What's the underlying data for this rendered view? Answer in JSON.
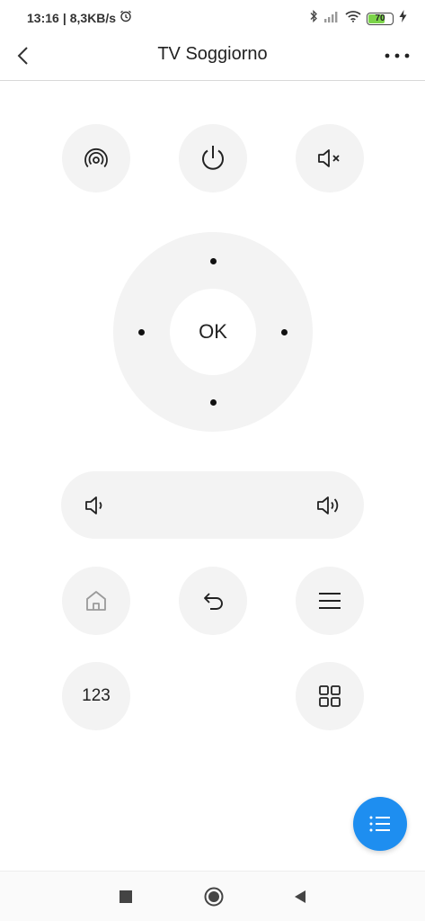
{
  "status_bar": {
    "time": "13:16",
    "speed": "8,3KB/s",
    "battery": "70",
    "battery_level": 0.7,
    "icons": [
      "alarm-icon",
      "bluetooth-icon",
      "signal-icon",
      "wifi-icon",
      "battery-icon",
      "charging-icon"
    ]
  },
  "header": {
    "title": "TV Soggiorno"
  },
  "buttons": {
    "source": {
      "icon": "source-icon"
    },
    "power": {
      "icon": "power-icon"
    },
    "mute": {
      "icon": "mute-icon"
    },
    "ok": "OK",
    "volume_down": {
      "icon": "volume-down-icon"
    },
    "volume_up": {
      "icon": "volume-up-icon"
    },
    "home": {
      "icon": "home-icon"
    },
    "back": {
      "icon": "return-icon"
    },
    "menu": {
      "icon": "menu-icon"
    },
    "numpad": "123",
    "apps": {
      "icon": "grid-icon"
    }
  },
  "colors": {
    "accent": "#1e8ef0",
    "button_bg": "#f3f3f3",
    "battery_fill": "#7cd44a"
  }
}
